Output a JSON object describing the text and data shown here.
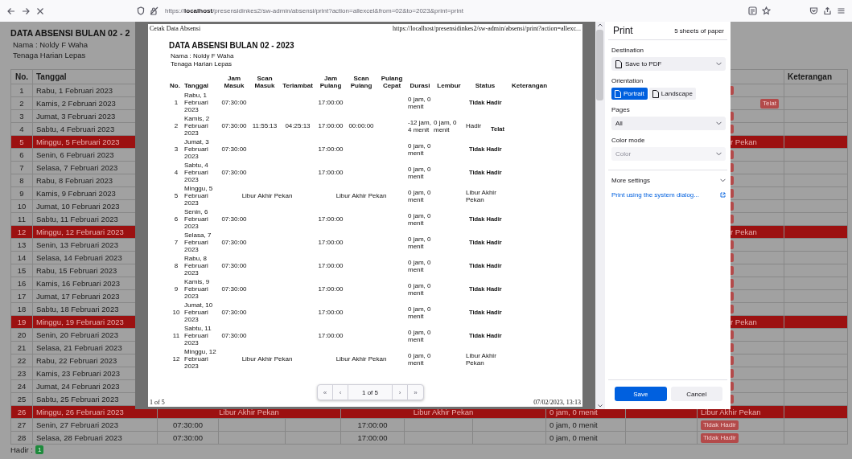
{
  "browser": {
    "url": "https://**localhost**/presensidinkes2/sw-admin/absensi/print?action=allexcel&from=02&to=2023&print=print"
  },
  "page": {
    "title": "DATA ABSENSI BULAN 02 - 2",
    "name": "Nama : Noldy F Waha",
    "role": "Tenaga Harian Lepas",
    "table": {
      "columns": [
        {
          "label": "No."
        },
        {
          "label": "Tanggal"
        },
        {
          "label": "Keterangan"
        }
      ],
      "rows": [
        {
          "no": "1",
          "date": "Rabu, 1 Februari 2023",
          "kind": "absent",
          "partly_hidden": true
        },
        {
          "no": "2",
          "date": "Kamis, 2 Februari 2023",
          "kind": "present",
          "partly_hidden": true,
          "status_badge": "Telat"
        },
        {
          "no": "3",
          "date": "Jumat, 3 Februari 2023",
          "kind": "absent",
          "partly_hidden": true
        },
        {
          "no": "4",
          "date": "Sabtu, 4 Februari 2023",
          "kind": "absent",
          "partly_hidden": true
        },
        {
          "no": "5",
          "date": "Minggu, 5 Februari 2023",
          "kind": "holiday",
          "partly_hidden": true,
          "status": "r Pekan"
        },
        {
          "no": "6",
          "date": "Senin, 6 Februari 2023",
          "kind": "absent",
          "partly_hidden": true
        },
        {
          "no": "7",
          "date": "Selasa, 7 Februari 2023",
          "kind": "absent",
          "partly_hidden": true
        },
        {
          "no": "8",
          "date": "Rabu, 8 Februari 2023",
          "kind": "absent",
          "partly_hidden": true
        },
        {
          "no": "9",
          "date": "Kamis, 9 Februari 2023",
          "kind": "absent",
          "partly_hidden": true
        },
        {
          "no": "10",
          "date": "Jumat, 10 Februari 2023",
          "kind": "absent",
          "partly_hidden": true
        },
        {
          "no": "11",
          "date": "Sabtu, 11 Februari 2023",
          "kind": "absent",
          "partly_hidden": true
        },
        {
          "no": "12",
          "date": "Minggu, 12 Februari 2023",
          "kind": "holiday",
          "partly_hidden": true,
          "status": "r Pekan"
        },
        {
          "no": "13",
          "date": "Senin, 13 Februari 2023",
          "kind": "absent",
          "partly_hidden": true
        },
        {
          "no": "14",
          "date": "Selasa, 14 Februari 2023",
          "kind": "absent",
          "partly_hidden": true
        },
        {
          "no": "15",
          "date": "Rabu, 15 Februari 2023",
          "kind": "absent",
          "partly_hidden": true
        },
        {
          "no": "16",
          "date": "Kamis, 16 Februari 2023",
          "kind": "absent",
          "partly_hidden": true
        },
        {
          "no": "17",
          "date": "Jumat, 17 Februari 2023",
          "kind": "absent",
          "partly_hidden": true
        },
        {
          "no": "18",
          "date": "Sabtu, 18 Februari 2023",
          "kind": "absent",
          "partly_hidden": true
        },
        {
          "no": "19",
          "date": "Minggu, 19 Februari 2023",
          "kind": "holiday",
          "partly_hidden": true,
          "status": "r Pekan"
        },
        {
          "no": "20",
          "date": "Senin, 20 Februari 2023",
          "kind": "absent",
          "partly_hidden": true
        },
        {
          "no": "21",
          "date": "Selasa, 21 Februari 2023",
          "kind": "absent",
          "partly_hidden": true
        },
        {
          "no": "22",
          "date": "Rabu, 22 Februari 2023",
          "kind": "absent",
          "partly_hidden": true
        },
        {
          "no": "23",
          "date": "Kamis, 23 Februari 2023",
          "kind": "absent",
          "partly_hidden": true
        },
        {
          "no": "24",
          "date": "Jumat, 24 Februari 2023",
          "kind": "absent",
          "partly_hidden": true
        },
        {
          "no": "25",
          "date": "Sabtu, 25 Februari 2023",
          "kind": "absent",
          "partly_hidden": true
        },
        {
          "no": "26",
          "date": "Minggu, 26 Februari 2023",
          "kind": "holiday",
          "partly_hidden": false,
          "masuk_note": "Libur Akhir Pekan",
          "pulang_note": "Libur Akhir Pekan",
          "duration": "0 jam, 0 menit",
          "status": "Libur Akhir Pekan"
        },
        {
          "no": "27",
          "date": "Senin, 27 Februari 2023",
          "kind": "absent",
          "partly_hidden": false,
          "jam_masuk": "07:30:00",
          "jam_pulang": "17:00:00",
          "duration": "0 jam, 0 menit",
          "status_badge": "Tidak Hadir"
        },
        {
          "no": "28",
          "date": "Selasa, 28 Februari 2023",
          "kind": "absent",
          "partly_hidden": false,
          "jam_masuk": "07:30:00",
          "jam_pulang": "17:00:00",
          "duration": "0 jam, 0 menit",
          "status_badge": "Tidak Hadir"
        }
      ]
    },
    "summary": {
      "label": "Hadir :",
      "count": "1"
    }
  },
  "print_preview": {
    "header_left": "Cetak Data Absensi",
    "header_right": "https://localhost/presensidinkes2/sw-admin/absensi/print?action=allexc...",
    "title": "DATA ABSENSI BULAN 02 - 2023",
    "name": "Nama : Noldy F Waha",
    "role": "Tenaga Harian Lepas",
    "table": {
      "columns": [
        {
          "label": "No."
        },
        {
          "label": "Tanggal"
        },
        {
          "label": "Jam Masuk"
        },
        {
          "label": "Scan Masuk"
        },
        {
          "label": "Terlambat"
        },
        {
          "label": "Jam Pulang"
        },
        {
          "label": "Scan Pulang"
        },
        {
          "label": "Pulang Cepat"
        },
        {
          "label": "Durasi"
        },
        {
          "label": "Lembur"
        },
        {
          "label": "Status"
        },
        {
          "label": "Keterangan"
        }
      ],
      "rows": [
        {
          "no": "1",
          "date": "Rabu, 1 Februari 2023",
          "kind": "absent",
          "jam_masuk": "07:30:00",
          "jam_pulang": "17:00:00",
          "duration": "0 jam, 0 menit",
          "status_badge": "Tidak Hadir"
        },
        {
          "no": "2",
          "date": "Kamis, 2 Februari 2023",
          "kind": "present",
          "jam_masuk": "07:30:00",
          "scan_masuk": "11:55:13",
          "terlambat": "04:25:13",
          "jam_pulang": "17:00:00",
          "scan_pulang": "00:00:00",
          "duration": "-12 jam, 4 menit",
          "lembur": "0 jam, 0 menit",
          "status": "Hadir",
          "status_badge": "Telat"
        },
        {
          "no": "3",
          "date": "Jumat, 3 Februari 2023",
          "kind": "absent",
          "jam_masuk": "07:30:00",
          "jam_pulang": "17:00:00",
          "duration": "0 jam, 0 menit",
          "status_badge": "Tidak Hadir"
        },
        {
          "no": "4",
          "date": "Sabtu, 4 Februari 2023",
          "kind": "absent",
          "jam_masuk": "07:30:00",
          "jam_pulang": "17:00:00",
          "duration": "0 jam, 0 menit",
          "status_badge": "Tidak Hadir"
        },
        {
          "no": "5",
          "date": "Minggu, 5 Februari 2023",
          "kind": "holiday",
          "masuk_note": "Libur Akhir Pekan",
          "pulang_note": "Libur Akhir Pekan",
          "duration": "0 jam, 0 menit",
          "status": "Libur Akhir Pekan"
        },
        {
          "no": "6",
          "date": "Senin, 6 Februari 2023",
          "kind": "absent",
          "jam_masuk": "07:30:00",
          "jam_pulang": "17:00:00",
          "duration": "0 jam, 0 menit",
          "status_badge": "Tidak Hadir"
        },
        {
          "no": "7",
          "date": "Selasa, 7 Februari 2023",
          "kind": "absent",
          "jam_masuk": "07:30:00",
          "jam_pulang": "17:00:00",
          "duration": "0 jam, 0 menit",
          "status_badge": "Tidak Hadir"
        },
        {
          "no": "8",
          "date": "Rabu, 8 Februari 2023",
          "kind": "absent",
          "jam_masuk": "07:30:00",
          "jam_pulang": "17:00:00",
          "duration": "0 jam, 0 menit",
          "status_badge": "Tidak Hadir"
        },
        {
          "no": "9",
          "date": "Kamis, 9 Februari 2023",
          "kind": "absent",
          "jam_masuk": "07:30:00",
          "jam_pulang": "17:00:00",
          "duration": "0 jam, 0 menit",
          "status_badge": "Tidak Hadir"
        },
        {
          "no": "10",
          "date": "Jumat, 10 Februari 2023",
          "kind": "absent",
          "jam_masuk": "07:30:00",
          "jam_pulang": "17:00:00",
          "duration": "0 jam, 0 menit",
          "status_badge": "Tidak Hadir"
        },
        {
          "no": "11",
          "date": "Sabtu, 11 Februari 2023",
          "kind": "absent",
          "jam_masuk": "07:30:00",
          "jam_pulang": "17:00:00",
          "duration": "0 jam, 0 menit",
          "status_badge": "Tidak Hadir"
        },
        {
          "no": "12",
          "date": "Minggu, 12 Februari 2023",
          "kind": "holiday",
          "masuk_note": "Libur Akhir Pekan",
          "pulang_note": "Libur Akhir Pekan",
          "duration": "0 jam, 0 menit",
          "status": "Libur Akhir Pekan"
        }
      ]
    },
    "footer_left": "1 of 5",
    "footer_right": "07/02/2023, 13:13",
    "pager": {
      "first": "«",
      "prev": "‹",
      "page": "1 of 5",
      "next": "›",
      "last": "»"
    }
  },
  "print_dialog": {
    "title": "Print",
    "sheets": "5 sheets of paper",
    "destination": {
      "label": "Destination",
      "value": "Save to PDF"
    },
    "orientation": {
      "label": "Orientation",
      "options": [
        {
          "label": "Portrait",
          "selected": true
        },
        {
          "label": "Landscape",
          "selected": false
        }
      ]
    },
    "pages": {
      "label": "Pages",
      "value": "All"
    },
    "color_mode": {
      "label": "Color mode",
      "value": "Color",
      "disabled": true
    },
    "more_settings": "More settings",
    "system_dialog_link": "Print using the system dialog...",
    "buttons": [
      {
        "label": "Save",
        "kind": "primary"
      },
      {
        "label": "Cancel",
        "kind": "secondary"
      }
    ]
  }
}
